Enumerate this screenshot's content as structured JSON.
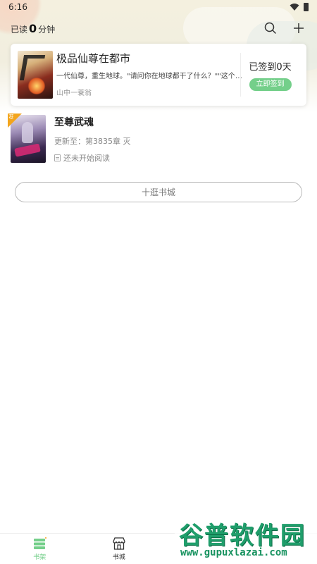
{
  "status_bar": {
    "time": "6:16"
  },
  "header": {
    "read_prefix": "已读",
    "read_minutes": "0",
    "read_suffix": "分钟"
  },
  "featured_book": {
    "title": "极品仙尊在都市",
    "description": "一代仙尊，重生地球。\"请问你在地球都干了什么？\"\"这个嘛...",
    "author": "山中一蓑翁",
    "signin_status": "已签到0天",
    "signin_button": "立即签到"
  },
  "shelf": {
    "books": [
      {
        "title": "至尊武魂",
        "update": "更新至：第3835章 灭",
        "progress": "还未开始阅读",
        "badge": "荐"
      }
    ],
    "browse_button": "十逛书城"
  },
  "tabbar": {
    "tabs": [
      {
        "label": "书架",
        "icon": "bookshelf-icon",
        "active": true
      },
      {
        "label": "书城",
        "icon": "store-icon",
        "active": false
      }
    ]
  },
  "watermark": {
    "text": "谷普软件园",
    "url": "www.gupuxlazai.com"
  },
  "colors": {
    "accent": "#74cf8a",
    "badge": "#f3a51d",
    "watermark": "#1f9e6b"
  }
}
